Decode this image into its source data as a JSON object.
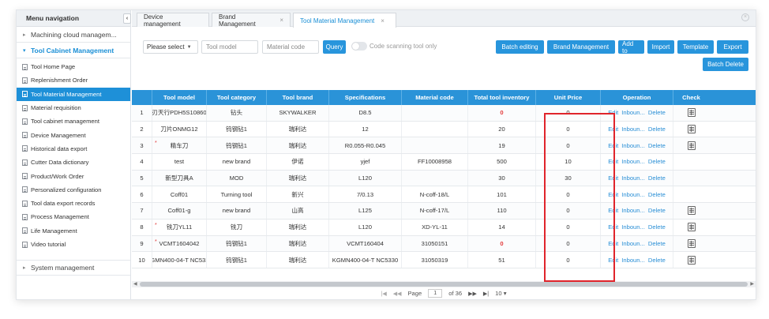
{
  "sidebar": {
    "title": "Menu navigation",
    "collapse_icon": "‹",
    "groups": [
      {
        "label": "Machining cloud managem..."
      },
      {
        "label": "Tool Cabinet Management"
      }
    ],
    "items": [
      {
        "label": "Tool Home Page"
      },
      {
        "label": "Replenishment Order"
      },
      {
        "label": "Tool Material Management"
      },
      {
        "label": "Material requisition"
      },
      {
        "label": "Tool cabinet management"
      },
      {
        "label": "Device Management"
      },
      {
        "label": "Historical data export"
      },
      {
        "label": "Cutter Data dictionary"
      },
      {
        "label": "Product/Work Order"
      },
      {
        "label": "Personalized configuration"
      },
      {
        "label": "Tool data export records"
      },
      {
        "label": "Process Management"
      },
      {
        "label": "Life Management"
      },
      {
        "label": "Video tutorial"
      }
    ],
    "bottom_group": "System management"
  },
  "tabs": [
    {
      "label": "Device management",
      "close": ""
    },
    {
      "label": "Brand Management",
      "close": "×"
    },
    {
      "label": "Tool Material Management",
      "close": "×"
    }
  ],
  "toolbar": {
    "select_value": "Please select",
    "tool_model_placeholder": "Tool model",
    "material_code_placeholder": "Material code",
    "query_label": "Query",
    "code_scanning_label": "Code scanning tool only",
    "batch_editing": "Batch editing",
    "brand_management": "Brand Management",
    "add_to": "Add to",
    "import": "Import",
    "template": "Template",
    "export": "Export",
    "batch_delete": "Batch Delete"
  },
  "table": {
    "headers": {
      "model": "Tool model",
      "category": "Tool category",
      "brand": "Tool brand",
      "spec": "Specifications",
      "material": "Material code",
      "inventory": "Total tool inventory",
      "price": "Unit Price",
      "operation": "Operation",
      "check": "Check"
    },
    "op": {
      "edit": "Edit",
      "inbound": "Inboun...",
      "delete": "Delete"
    },
    "rows": [
      {
        "idx": "1",
        "model": "刃天行PDH5S10860",
        "category": "钻头",
        "brand": "SKYWALKER",
        "spec": "D8.5",
        "material": "",
        "inventory": "0",
        "price": "0"
      },
      {
        "idx": "2",
        "model": "刀片ONMG12",
        "category": "钨钢钻1",
        "brand": "瑞利达",
        "spec": "12",
        "material": "",
        "inventory": "20",
        "price": "0"
      },
      {
        "idx": "3",
        "model": "精车刀",
        "category": "钨钢钻1",
        "brand": "瑞利达",
        "spec": "R0.055-R0.045",
        "material": "",
        "inventory": "19",
        "price": "0"
      },
      {
        "idx": "4",
        "model": "test",
        "category": "new brand",
        "brand": "伊诺",
        "spec": "yjef",
        "material": "FF10008958",
        "inventory": "500",
        "price": "10"
      },
      {
        "idx": "5",
        "model": "新型刀具A",
        "category": "MOD",
        "brand": "瑞利达",
        "spec": "L120",
        "material": "",
        "inventory": "30",
        "price": "30"
      },
      {
        "idx": "6",
        "model": "Coff01",
        "category": "Turning tool",
        "brand": "新兴",
        "spec": "7/0.13",
        "material": "N-coff-18/L",
        "inventory": "101",
        "price": "0"
      },
      {
        "idx": "7",
        "model": "Coff01-g",
        "category": "new brand",
        "brand": "山高",
        "spec": "L125",
        "material": "N-coff-17/L",
        "inventory": "110",
        "price": "0"
      },
      {
        "idx": "8",
        "model": "铣刀YL11",
        "category": "铣刀",
        "brand": "瑞利达",
        "spec": "L120",
        "material": "XD-YL-11",
        "inventory": "14",
        "price": "0"
      },
      {
        "idx": "9",
        "model": "VCMT1604042",
        "category": "钨钢钻1",
        "brand": "瑞利达",
        "spec": "VCMT160404",
        "material": "31050151",
        "inventory": "0",
        "price": "0"
      },
      {
        "idx": "10",
        "model": "KGMN400-04-T NC5330",
        "category": "钨钢钻1",
        "brand": "瑞利达",
        "spec": "KGMN400-04-T NC5330",
        "material": "31050319",
        "inventory": "51",
        "price": "0"
      }
    ]
  },
  "pager": {
    "page_label": "Page",
    "page_value": "1",
    "of_label": "of 36",
    "page_size": "10"
  },
  "colors": {
    "accent": "#2a93d8",
    "zero_inventory": "#e23b3b",
    "highlight_box": "#e0242b"
  }
}
